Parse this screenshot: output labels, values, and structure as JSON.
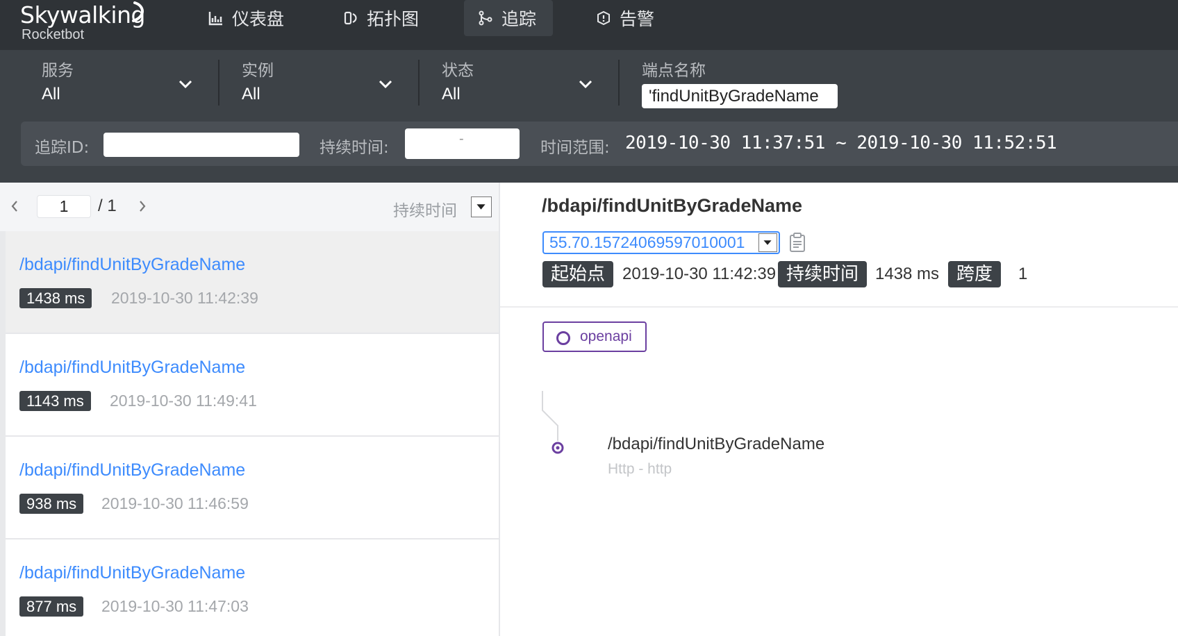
{
  "app": {
    "logo_main": "Skywalking",
    "logo_sub": "Rocketbot"
  },
  "nav": {
    "items": [
      {
        "label": "仪表盘",
        "icon": "chart-icon"
      },
      {
        "label": "拓扑图",
        "icon": "topology-icon"
      },
      {
        "label": "追踪",
        "icon": "trace-icon",
        "active": true
      },
      {
        "label": "告警",
        "icon": "alarm-icon"
      }
    ]
  },
  "filters": {
    "service": {
      "label": "服务",
      "value": "All"
    },
    "instance": {
      "label": "实例",
      "value": "All"
    },
    "status": {
      "label": "状态",
      "value": "All"
    },
    "endpoint": {
      "label": "端点名称",
      "value": "'findUnitByGradeName"
    }
  },
  "search": {
    "trace_id_label": "追踪ID:",
    "trace_id_value": "",
    "duration_label": "持续时间:",
    "duration_separator": "-",
    "time_range_label": "时间范围:",
    "time_range_value": "2019-10-30 11:37:51 ~ 2019-10-30 11:52:51"
  },
  "pager": {
    "current_page": "1",
    "total": "/ 1",
    "sort_label": "持续时间"
  },
  "traces": [
    {
      "endpoint": "/bdapi/findUnitByGradeName",
      "duration": "1438 ms",
      "start": "2019-10-30 11:42:39",
      "selected": true
    },
    {
      "endpoint": "/bdapi/findUnitByGradeName",
      "duration": "1143 ms",
      "start": "2019-10-30 11:49:41"
    },
    {
      "endpoint": "/bdapi/findUnitByGradeName",
      "duration": "938 ms",
      "start": "2019-10-30 11:46:59"
    },
    {
      "endpoint": "/bdapi/findUnitByGradeName",
      "duration": "877 ms",
      "start": "2019-10-30 11:47:03"
    }
  ],
  "detail": {
    "title": "/bdapi/findUnitByGradeName",
    "trace_id": "55.70.15724069597010001",
    "start_label": "起始点",
    "start_value": "2019-10-30 11:42:39",
    "duration_label": "持续时间",
    "duration_value": "1438 ms",
    "span_label": "跨度",
    "span_value": "1",
    "service_legend": "openapi",
    "span": {
      "name": "/bdapi/findUnitByGradeName",
      "sub": "Http - http"
    }
  },
  "colors": {
    "nav_bg": "#2f3337",
    "bar_bg": "#3d4247",
    "link": "#3d8bfd",
    "service": "#6b3fa0"
  }
}
